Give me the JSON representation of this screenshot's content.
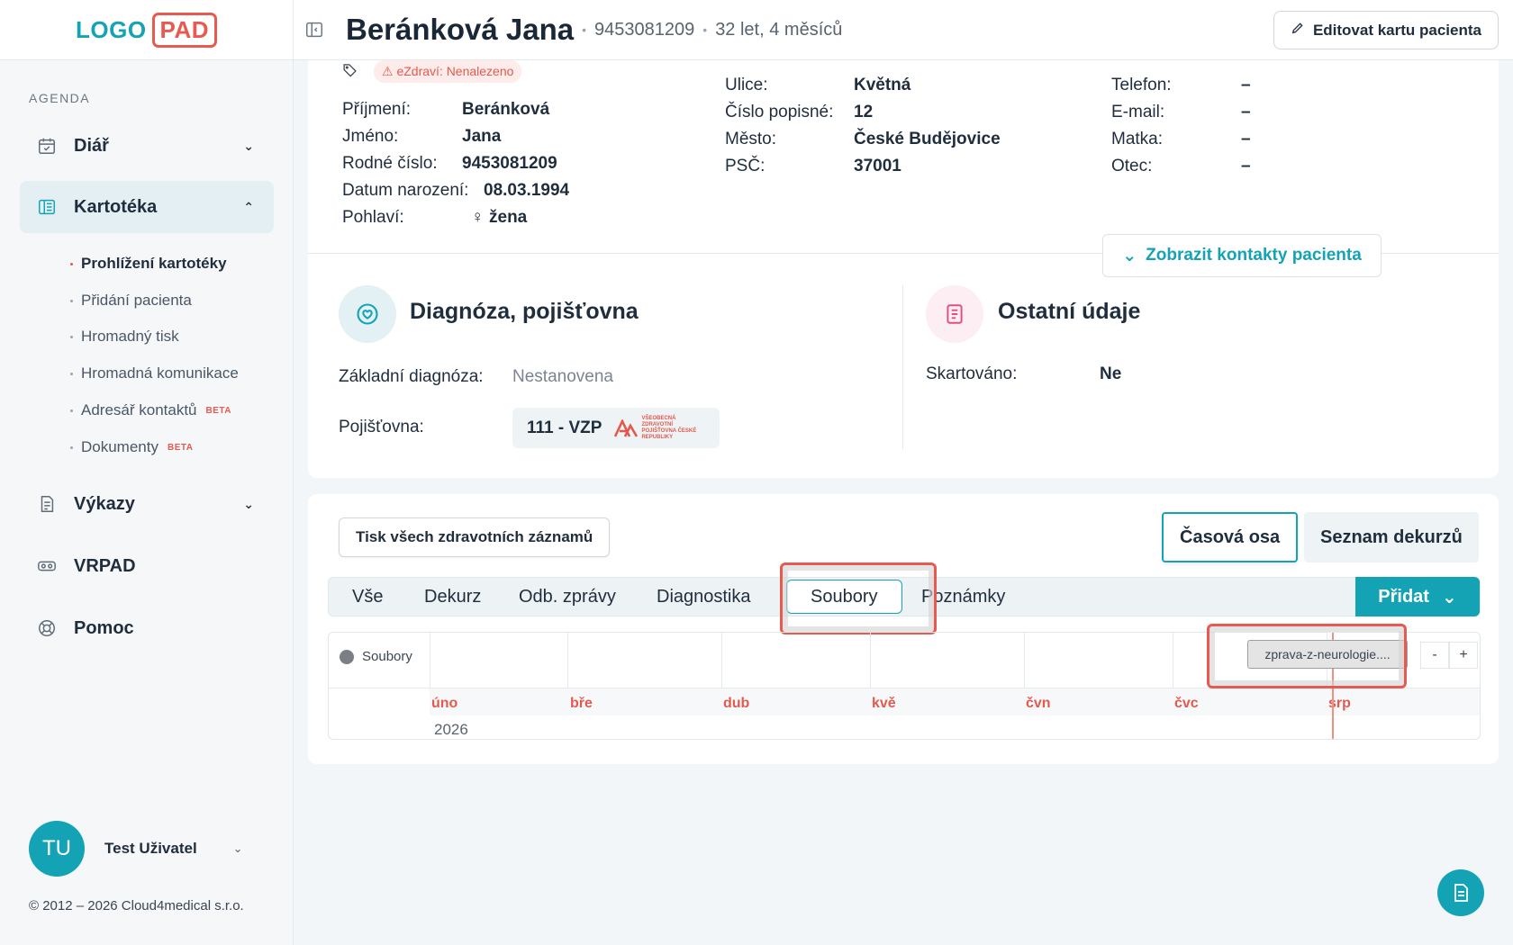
{
  "logo": {
    "part1": "LOGO",
    "part2": "PAD"
  },
  "sidebar": {
    "section": "AGENDA",
    "items": [
      {
        "label": "Diář"
      },
      {
        "label": "Kartotéka"
      },
      {
        "label": "Výkazy"
      },
      {
        "label": "VRPAD"
      },
      {
        "label": "Pomoc"
      }
    ],
    "subitems": [
      {
        "label": "Prohlížení kartotéky"
      },
      {
        "label": "Přidání pacienta"
      },
      {
        "label": "Hromadný tisk"
      },
      {
        "label": "Hromadná komunikace"
      },
      {
        "label": "Adresář kontaktů",
        "badge": "BETA"
      },
      {
        "label": "Dokumenty",
        "badge": "BETA"
      }
    ],
    "user": {
      "initials": "TU",
      "name": "Test Uživatel"
    },
    "footer": "© 2012 – 2026 Cloud4medical s.r.o."
  },
  "header": {
    "patient_name": "Beránková Jana",
    "birth_number": "9453081209",
    "age": "32 let, 4 měsíců",
    "edit_button": "Editovat kartu pacienta"
  },
  "patient": {
    "ezdravi": "eZdraví: Nenalezeno",
    "personal": [
      {
        "key": "Příjmení:",
        "value": "Beránková"
      },
      {
        "key": "Jméno:",
        "value": "Jana"
      },
      {
        "key": "Rodné číslo:",
        "value": "9453081209"
      },
      {
        "key": "Datum narození:",
        "value": "08.03.1994"
      },
      {
        "key": "Pohlaví:",
        "value": "žena"
      }
    ],
    "address": [
      {
        "key": "Ulice:",
        "value": "Květná"
      },
      {
        "key": "Číslo popisné:",
        "value": "12"
      },
      {
        "key": "Město:",
        "value": "České Budějovice"
      },
      {
        "key": "PSČ:",
        "value": "37001"
      }
    ],
    "contacts": [
      {
        "key": "Telefon:",
        "value": "–"
      },
      {
        "key": "E-mail:",
        "value": "–"
      },
      {
        "key": "Matka:",
        "value": "–"
      },
      {
        "key": "Otec:",
        "value": "–"
      }
    ],
    "show_contacts_button": "Zobrazit kontakty pacienta"
  },
  "diagnosis": {
    "title": "Diagnóza, pojišťovna",
    "base_label": "Základní diagnóza:",
    "base_value": "Nestanovena",
    "insurance_label": "Pojišťovna:",
    "insurance_value": "111 - VZP",
    "insurer_logo_text": "VŠEOBECNÁ ZDRAVOTNÍ POJIŠŤOVNA ČESKÉ REPUBLIKY"
  },
  "other": {
    "title": "Ostatní údaje",
    "shredded_label": "Skartováno:",
    "shredded_value": "Ne"
  },
  "records": {
    "print_button": "Tisk všech zdravotních záznamů",
    "view_timeline": "Časová osa",
    "view_list": "Seznam dekurzů",
    "tabs": [
      "Vše",
      "Dekurz",
      "Odb. zprávy",
      "Diagnostika",
      "Soubory",
      "Poznámky"
    ],
    "selected_tab": "Soubory",
    "add_button": "Přidat"
  },
  "timeline": {
    "legend": "Soubory",
    "months": [
      "úno",
      "bře",
      "dub",
      "kvě",
      "čvn",
      "čvc",
      "srp"
    ],
    "year": "2026",
    "file_item": "zprava-z-neurologie....",
    "zoom_out": "-",
    "zoom_in": "+"
  },
  "colors": {
    "accent": "#14a3b5",
    "highlight": "#e85a4f"
  }
}
